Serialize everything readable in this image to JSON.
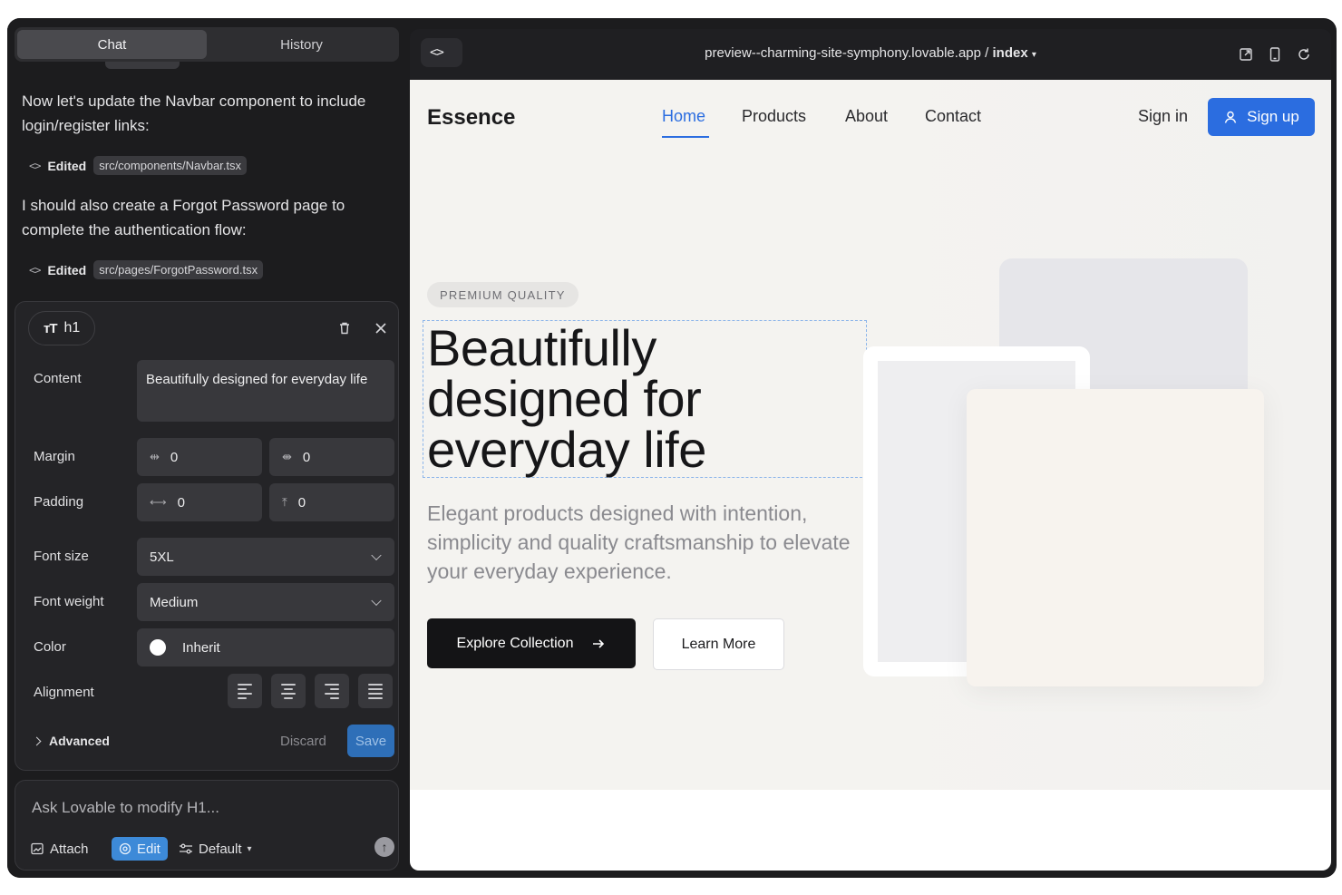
{
  "left_panel": {
    "tabs": [
      {
        "label": "Chat",
        "active": true
      },
      {
        "label": "History",
        "active": false
      }
    ],
    "messages": [
      {
        "text": "Now let's update the Navbar component to include login/register links:"
      },
      {
        "text": "I should also create a Forgot Password page to complete the authentication flow:"
      }
    ],
    "edits": [
      {
        "label": "Edited",
        "path": "src/components/Navbar.tsx"
      },
      {
        "label": "Edited",
        "path": "src/pages/ForgotPassword.tsx"
      }
    ],
    "editor": {
      "element_tag": "h1",
      "content_label": "Content",
      "content_value": "Beautifully designed for everyday life",
      "margin_label": "Margin",
      "margin_x": "0",
      "margin_y": "0",
      "padding_label": "Padding",
      "padding_x": "0",
      "padding_y": "0",
      "font_size_label": "Font size",
      "font_size_value": "5XL",
      "font_weight_label": "Font weight",
      "font_weight_value": "Medium",
      "color_label": "Color",
      "color_value": "Inherit",
      "alignment_label": "Alignment",
      "advanced_label": "Advanced",
      "discard_label": "Discard",
      "save_label": "Save"
    },
    "input": {
      "placeholder": "Ask Lovable to modify H1...",
      "attach_label": "Attach",
      "edit_label": "Edit",
      "default_label": "Default"
    }
  },
  "preview": {
    "url_prefix": "preview--charming-site-symphony.lovable.app / ",
    "url_page": "index",
    "site": {
      "logo": "Essence",
      "nav": [
        {
          "label": "Home",
          "active": true
        },
        {
          "label": "Products",
          "active": false
        },
        {
          "label": "About",
          "active": false
        },
        {
          "label": "Contact",
          "active": false
        }
      ],
      "signin_label": "Sign in",
      "signup_label": "Sign up",
      "badge": "PREMIUM QUALITY",
      "headline": "Beautifully designed for everyday life",
      "subtitle": "Elegant products designed with intention, simplicity and quality craftsmanship to elevate your everyday experience.",
      "primary_cta": "Explore Collection",
      "secondary_cta": "Learn More"
    }
  },
  "colors": {
    "accent_blue": "#2b6de0",
    "panel_dark": "#1c1c1e",
    "hero_bg": "#f4f3f0"
  },
  "icons": [
    "code-icon",
    "text-type-icon",
    "trash-icon",
    "close-icon",
    "chevron-down-icon",
    "external-link-icon",
    "mobile-icon",
    "refresh-icon",
    "user-icon",
    "arrow-right-icon",
    "attach-icon",
    "target-icon",
    "sliders-icon",
    "arrow-up-icon"
  ]
}
